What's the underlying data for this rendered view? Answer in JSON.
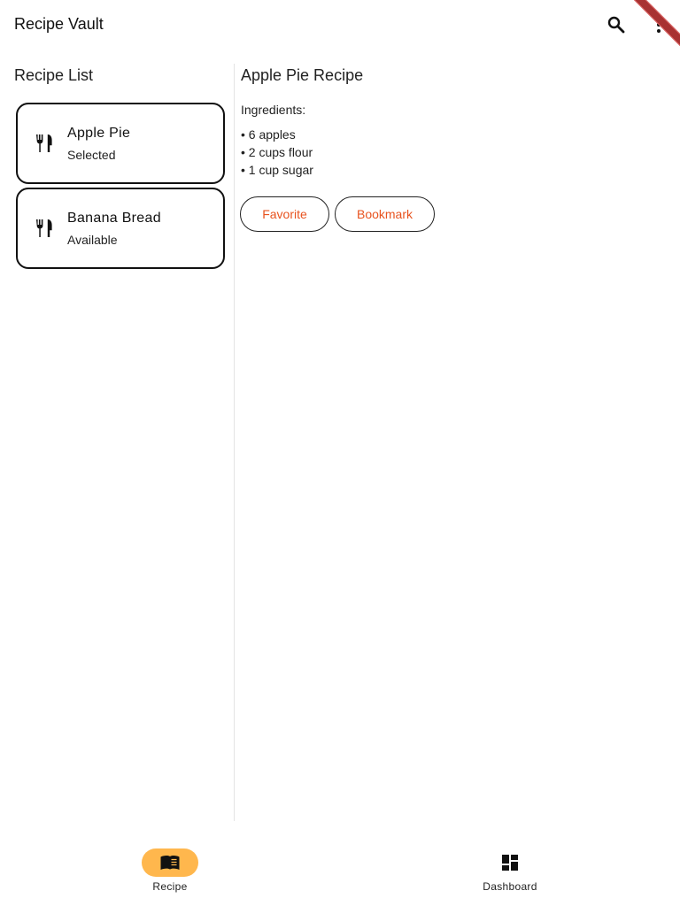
{
  "app": {
    "title": "Recipe Vault"
  },
  "colors": {
    "accent": "#e8531f",
    "nav_indicator": "#ffb74d",
    "debug_banner": "#a83232"
  },
  "appbar": {
    "actions": [
      {
        "icon": "search-icon"
      },
      {
        "icon": "more-vert-icon"
      }
    ]
  },
  "list": {
    "title": "Recipe List",
    "items": [
      {
        "name": "Apple Pie",
        "status": "Selected",
        "icon": "restaurant-icon"
      },
      {
        "name": "Banana Bread",
        "status": "Available",
        "icon": "restaurant-icon"
      }
    ]
  },
  "detail": {
    "title": "Apple Pie Recipe",
    "ingredients_label": "Ingredients:",
    "ingredients": [
      "• 6 apples",
      "• 2 cups flour",
      "• 1 cup sugar"
    ],
    "actions": {
      "favorite": "Favorite",
      "bookmark": "Bookmark"
    }
  },
  "bottom_nav": {
    "items": [
      {
        "label": "Recipe",
        "icon": "menu-book-icon",
        "selected": true
      },
      {
        "label": "Dashboard",
        "icon": "dashboard-icon",
        "selected": false
      }
    ]
  }
}
